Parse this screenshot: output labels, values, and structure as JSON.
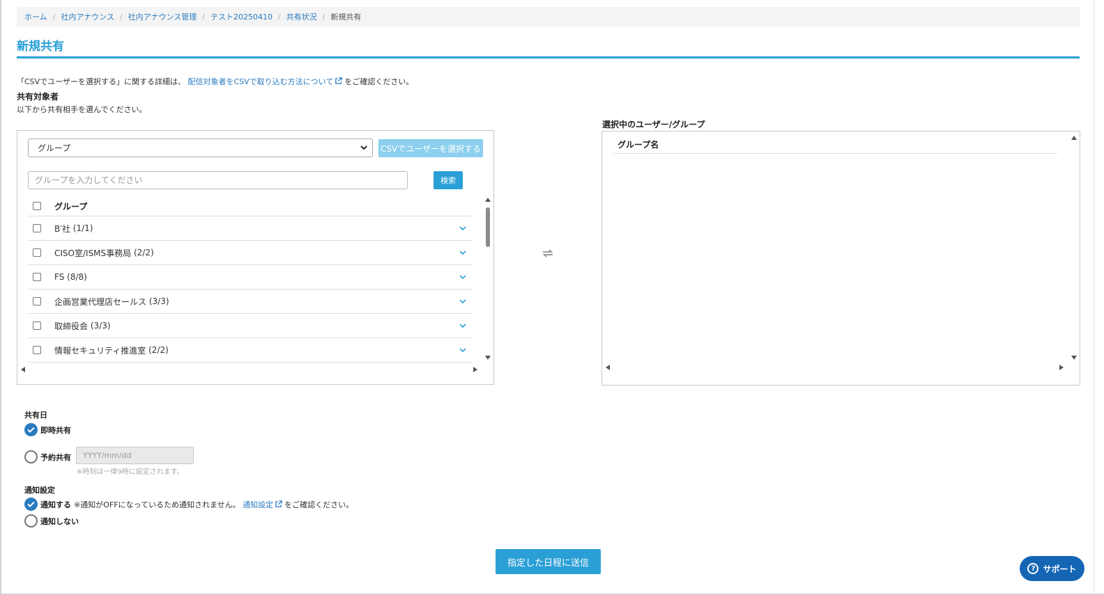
{
  "breadcrumb": {
    "items": [
      "ホーム",
      "社内アナウンス",
      "社内アナウンス管理",
      "テスト20250410",
      "共有状況"
    ],
    "current": "新規共有"
  },
  "page_title": "新規共有",
  "csv_note": {
    "prefix": "「CSVでユーザーを選択する」に関する詳細は、",
    "link": "配信対象者をCSVで取り込む方法について",
    "suffix": "をご確認ください。"
  },
  "target": {
    "heading": "共有対象者",
    "description": "以下から共有相手を選んでください。"
  },
  "left_panel": {
    "type_select": "グループ",
    "csv_button": "CSVでユーザーを選択する",
    "search_placeholder": "グループを入力してください",
    "search_button": "検索",
    "list_header": "グループ",
    "groups": [
      {
        "name": "B′社",
        "count": "(1/1)"
      },
      {
        "name": "CISO室/ISMS事務局",
        "count": "(2/2)"
      },
      {
        "name": "FS",
        "count": "(8/8)"
      },
      {
        "name": "企画営業代理店セールス",
        "count": "(3/3)"
      },
      {
        "name": "取締役会",
        "count": "(3/3)"
      },
      {
        "name": "情報セキュリティ推進室",
        "count": "(2/2)"
      }
    ]
  },
  "right_panel": {
    "label": "選択中のユーザー/グループ",
    "column_header": "グループ名"
  },
  "share_date": {
    "label": "共有日",
    "immediate": "即時共有",
    "scheduled": "予約共有",
    "date_placeholder": "YYYY/mm/dd",
    "time_note": "※時刻は一律9時に設定されます。",
    "selected": "immediate"
  },
  "notification": {
    "label": "通知設定",
    "on": "通知する",
    "on_note": "※通知がOFFになっているため通知されません。",
    "on_link": "通知設定",
    "on_suffix": "をご確認ください。",
    "off": "通知しない",
    "selected": "on"
  },
  "send_button": "指定した日程に送信",
  "support_button": "サポート",
  "colors": {
    "accent": "#2a9fd6",
    "link": "#2a7bc0",
    "csv_button": "#8ccfee",
    "support": "#1565b5"
  }
}
